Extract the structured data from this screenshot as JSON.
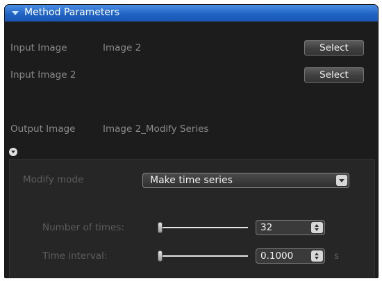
{
  "panel": {
    "title": "Method Parameters",
    "input_image_1": {
      "label": "Input Image",
      "value": "Image 2",
      "button": "Select"
    },
    "input_image_2": {
      "label": "Input Image 2",
      "value": "",
      "button": "Select"
    },
    "output_image": {
      "label": "Output Image",
      "value": "Image 2_Modify Series"
    },
    "modify_mode": {
      "label": "Modify mode",
      "selected": "Make time series"
    },
    "number_of_times": {
      "label": "Number of times:",
      "value": "32",
      "slider_fraction": 0.0
    },
    "time_interval": {
      "label": "Time interval:",
      "value": "0.1000",
      "unit": "s",
      "slider_fraction": 0.0
    }
  },
  "icons": {
    "collapse": "triangle-down-icon",
    "expand": "circle-chevron-down-icon",
    "dropdown": "chevron-down-icon",
    "spinner": "up-down-arrows-icon"
  }
}
